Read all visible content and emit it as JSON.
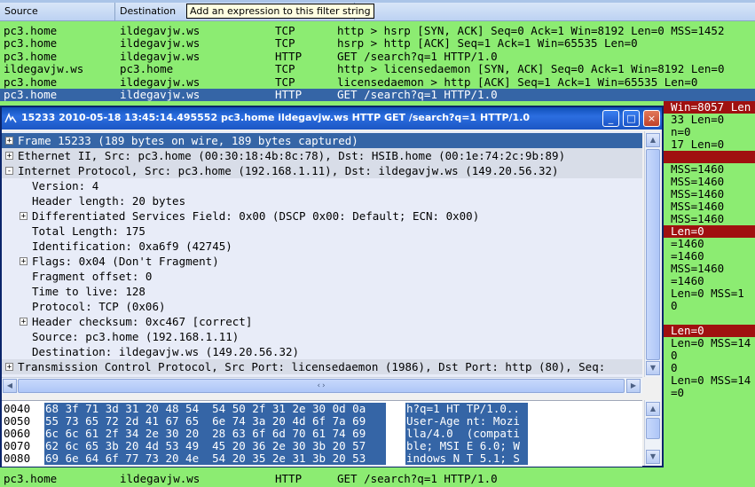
{
  "columns": {
    "source": "Source",
    "destination": "Destination",
    "tail": "o"
  },
  "tooltip": "Add an expression to this filter string",
  "packets": [
    {
      "src": "pc3.home",
      "dst": "ildegavjw.ws",
      "proto": "TCP",
      "info": "http > hsrp [SYN, ACK] Seq=0 Ack=1 Win=8192 Len=0 MSS=1452",
      "sel": false
    },
    {
      "src": "pc3.home",
      "dst": "ildegavjw.ws",
      "proto": "TCP",
      "info": "hsrp > http [ACK] Seq=1 Ack=1 Win=65535 Len=0",
      "sel": false
    },
    {
      "src": "pc3.home",
      "dst": "ildegavjw.ws",
      "proto": "HTTP",
      "info": "GET /search?q=1 HTTP/1.0",
      "sel": false
    },
    {
      "src": "ildegavjw.ws",
      "dst": "pc3.home",
      "proto": "TCP",
      "info": "http > licensedaemon [SYN, ACK] Seq=0 Ack=1 Win=8192 Len=0",
      "sel": false
    },
    {
      "src": "pc3.home",
      "dst": "ildegavjw.ws",
      "proto": "TCP",
      "info": "licensedaemon > http [ACK] Seq=1 Ack=1 Win=65535 Len=0",
      "sel": false
    },
    {
      "src": "pc3.home",
      "dst": "ildegavjw.ws",
      "proto": "HTTP",
      "info": "GET /search?q=1 HTTP/1.0",
      "sel": true
    }
  ],
  "bottom_packet": {
    "src": "pc3.home",
    "dst": "ildegavjw.ws",
    "proto": "HTTP",
    "info": "GET /search?q=1 HTTP/1.0"
  },
  "right_fragments": [
    {
      "text": "Win=8057 Len",
      "red": true
    },
    {
      "text": "33 Len=0",
      "red": false
    },
    {
      "text": "n=0",
      "red": false
    },
    {
      "text": "17 Len=0",
      "red": false
    },
    {
      "text": "",
      "red": true
    },
    {
      "text": "MSS=1460",
      "red": false
    },
    {
      "text": "MSS=1460",
      "red": false
    },
    {
      "text": "MSS=1460",
      "red": false
    },
    {
      "text": "MSS=1460",
      "red": false
    },
    {
      "text": "MSS=1460",
      "red": false
    },
    {
      "text": "Len=0",
      "red": true
    },
    {
      "text": "=1460",
      "red": false
    },
    {
      "text": "=1460",
      "red": false
    },
    {
      "text": "MSS=1460",
      "red": false
    },
    {
      "text": "=1460",
      "red": false
    },
    {
      "text": "Len=0 MSS=1",
      "red": false
    },
    {
      "text": "0",
      "red": false
    },
    {
      "text": "",
      "red": false
    },
    {
      "text": "Len=0",
      "red": true
    },
    {
      "text": "Len=0 MSS=14",
      "red": false
    },
    {
      "text": "0",
      "red": false
    },
    {
      "text": "0",
      "red": false
    },
    {
      "text": "Len=0 MSS=14",
      "red": false
    },
    {
      "text": "=0",
      "red": false
    }
  ],
  "window": {
    "title": "15233 2010-05-18 13:45:14.495552 pc3.home ildegavjw.ws HTTP GET /search?q=1 HTTP/1.0",
    "minimize": "_",
    "maximize": "□",
    "close": "×"
  },
  "tree": [
    {
      "indent": 0,
      "exp": "+",
      "text": "Frame 15233 (189 bytes on wire, 189 bytes captured)",
      "cls": "sel"
    },
    {
      "indent": 0,
      "exp": "+",
      "text": "Ethernet II, Src: pc3.home (00:30:18:4b:8c:78), Dst: HSIB.home (00:1e:74:2c:9b:89)",
      "cls": "top"
    },
    {
      "indent": 0,
      "exp": "-",
      "text": "Internet Protocol, Src: pc3.home (192.168.1.11), Dst: ildegavjw.ws (149.20.56.32)",
      "cls": "top"
    },
    {
      "indent": 1,
      "exp": "",
      "text": "Version: 4",
      "cls": ""
    },
    {
      "indent": 1,
      "exp": "",
      "text": "Header length: 20 bytes",
      "cls": ""
    },
    {
      "indent": 1,
      "exp": "+",
      "text": "Differentiated Services Field: 0x00 (DSCP 0x00: Default; ECN: 0x00)",
      "cls": ""
    },
    {
      "indent": 1,
      "exp": "",
      "text": "Total Length: 175",
      "cls": ""
    },
    {
      "indent": 1,
      "exp": "",
      "text": "Identification: 0xa6f9 (42745)",
      "cls": ""
    },
    {
      "indent": 1,
      "exp": "+",
      "text": "Flags: 0x04 (Don't Fragment)",
      "cls": ""
    },
    {
      "indent": 1,
      "exp": "",
      "text": "Fragment offset: 0",
      "cls": ""
    },
    {
      "indent": 1,
      "exp": "",
      "text": "Time to live: 128",
      "cls": ""
    },
    {
      "indent": 1,
      "exp": "",
      "text": "Protocol: TCP (0x06)",
      "cls": ""
    },
    {
      "indent": 1,
      "exp": "+",
      "text": "Header checksum: 0xc467 [correct]",
      "cls": ""
    },
    {
      "indent": 1,
      "exp": "",
      "text": "Source: pc3.home (192.168.1.11)",
      "cls": ""
    },
    {
      "indent": 1,
      "exp": "",
      "text": "Destination: ildegavjw.ws (149.20.56.32)",
      "cls": ""
    },
    {
      "indent": 0,
      "exp": "+",
      "text": "Transmission Control Protocol, Src Port: licensedaemon (1986), Dst Port: http (80), Seq:",
      "cls": "top"
    }
  ],
  "hex": [
    {
      "off": "0040",
      "bytes": "68 3f 71 3d 31 20 48 54  54 50 2f 31 2e 30 0d 0a",
      "ascii": "h?q=1 HT TP/1.0.."
    },
    {
      "off": "0050",
      "bytes": "55 73 65 72 2d 41 67 65  6e 74 3a 20 4d 6f 7a 69",
      "ascii": "User-Age nt: Mozi"
    },
    {
      "off": "0060",
      "bytes": "6c 6c 61 2f 34 2e 30 20  28 63 6f 6d 70 61 74 69",
      "ascii": "lla/4.0  (compati"
    },
    {
      "off": "0070",
      "bytes": "62 6c 65 3b 20 4d 53 49  45 20 36 2e 30 3b 20 57",
      "ascii": "ble; MSI E 6.0; W"
    },
    {
      "off": "0080",
      "bytes": "69 6e 64 6f 77 73 20 4e  54 20 35 2e 31 3b 20 53",
      "ascii": "indows N T 5.1; S"
    }
  ],
  "icons": {
    "window": "shark-fin-icon",
    "expand": "plus-box-icon",
    "collapse": "minus-box-icon"
  },
  "colors": {
    "selection": "#3565a6",
    "tcp_row": "#8cec72",
    "error_row": "#a01010",
    "titlebar": "#1b56c4"
  }
}
